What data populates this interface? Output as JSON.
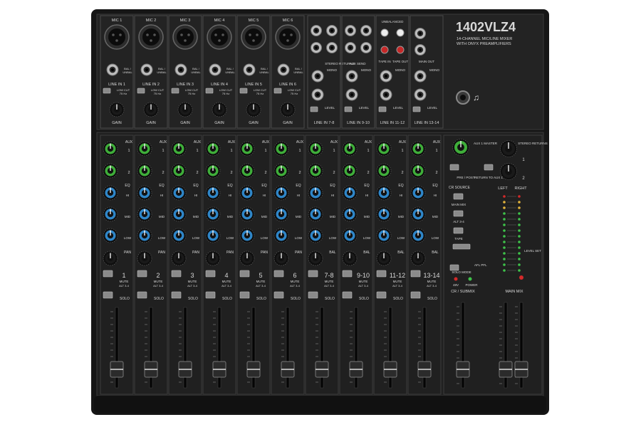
{
  "brand": {
    "model": "1402VLZ4",
    "tagline_1": "14-CHANNEL MIC/LINE MIXER",
    "tagline_2": "WITH ONYX PREAMPLIFIERS"
  },
  "top_panel": {
    "mic_labels": [
      "MIC 1",
      "MIC 2",
      "MIC 3",
      "MIC 4",
      "MIC 5",
      "MIC 6"
    ],
    "line_labels": [
      "LINE IN 1",
      "LINE IN 2",
      "LINE IN 3",
      "LINE IN 4",
      "LINE IN 5",
      "LINE IN 6"
    ],
    "bal_label": "BAL / UNBAL",
    "low_cut": "LOW CUT",
    "low_cut_freq": "75 Hz",
    "gain": "GAIN",
    "stereo_returns": "STEREO RETURNS",
    "aux_send": "AUX SEND",
    "unbalanced": "UNBALANCED",
    "tape_in": "TAPE IN",
    "tape_out": "TAPE OUT",
    "main_out": "MAIN OUT",
    "mono": "MONO",
    "level": "LEVEL",
    "stereo_line_labels": [
      "LINE IN 7-8",
      "LINE IN 9-10",
      "LINE IN 11-12",
      "LINE IN 13-14"
    ]
  },
  "strips": {
    "aux": "AUX",
    "eq": "EQ",
    "hi": "HI",
    "mid": "MID",
    "low": "LOW",
    "pan": "PAN",
    "bal": "BAL",
    "mute": "MUTE",
    "alt": "ALT 3-4",
    "solo": "SOLO",
    "numbers": [
      "1",
      "2",
      "3",
      "4",
      "5",
      "6",
      "7-8",
      "9-10",
      "11-12",
      "13-14"
    ]
  },
  "master": {
    "aux1_master": "AUX 1 MASTER",
    "stereo_returns": "STEREO RETURNS",
    "pre_post": "PRE / POST",
    "return_to_aux1": "RETURN TO AUX 1",
    "cr_source": "CR SOURCE",
    "main_mix": "MAIN MIX",
    "alt34": "ALT 3-4",
    "tape": "TAPE",
    "left": "LEFT",
    "right": "RIGHT",
    "level_set": "LEVEL SET",
    "solo_mode": "SOLO MODE",
    "afl_pfl": "AFL PFL",
    "phantom": "48V",
    "power": "POWER",
    "cr_submix": "CR / SUBMIX",
    "main_mix_fader": "MAIN MIX"
  },
  "colors": {
    "chassis": "#1c1c1c",
    "panel": "#262626",
    "aux_knob": "#3fae3a",
    "eq_knob": "#2f86c8",
    "button": "#8a8a8a",
    "led_green": "#3ec24a",
    "led_red": "#d42a2a"
  }
}
